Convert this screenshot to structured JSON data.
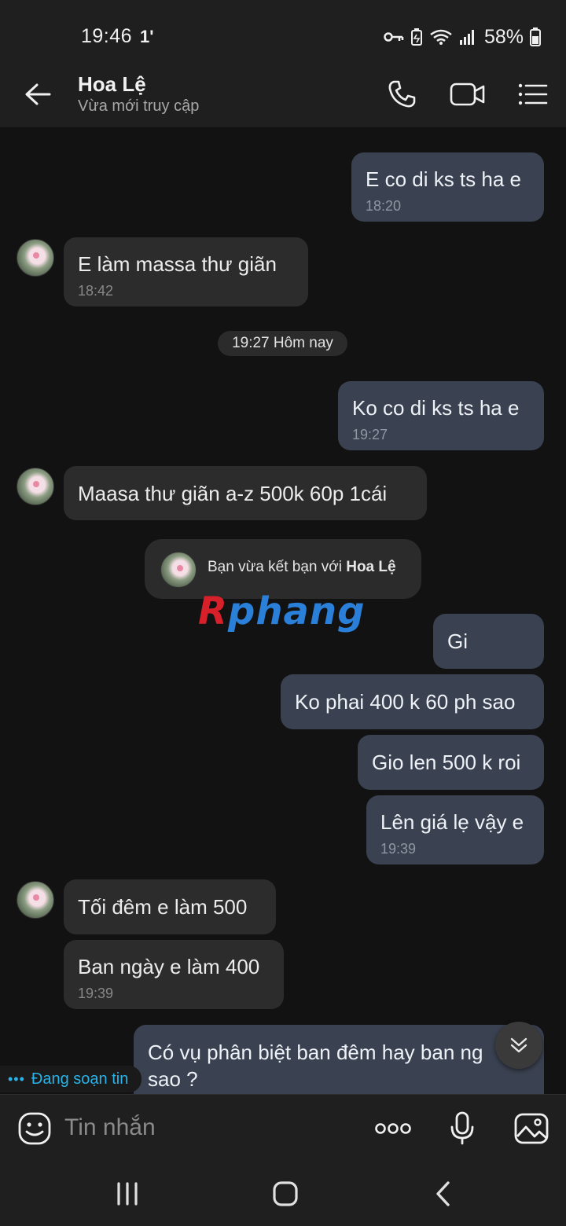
{
  "status_bar": {
    "time": "19:46",
    "time_indicator": "1'",
    "battery": "58%"
  },
  "header": {
    "contact_name": "Hoa Lệ",
    "contact_status": "Vừa mới truy cập"
  },
  "messages": [
    {
      "side": "out",
      "text": "E co di ks ts ha e",
      "time": "18:20"
    },
    {
      "side": "in",
      "text": "E làm massa thư giãn",
      "time": "18:42"
    },
    {
      "side": "out",
      "text": "Ko co di ks ts ha e",
      "time": "19:27"
    },
    {
      "side": "in",
      "text": "Maasa thư giãn a-z 500k 60p 1cái",
      "time": ""
    },
    {
      "side": "out",
      "text": "Gi",
      "time": ""
    },
    {
      "side": "out",
      "text": "Ko phai 400 k 60 ph sao",
      "time": ""
    },
    {
      "side": "out",
      "text": "Gio len 500 k roi",
      "time": ""
    },
    {
      "side": "out",
      "text": "Lên giá lẹ vậy e",
      "time": "19:39"
    },
    {
      "side": "in",
      "text": "Tối đêm e làm 500",
      "time": ""
    },
    {
      "side": "in",
      "text": "Ban ngày e làm 400",
      "time": "19:39"
    },
    {
      "side": "out",
      "text": "Có vụ phân biệt ban đêm hay ban ng\nsao ?",
      "time": ""
    }
  ],
  "date_separator": "19:27 Hôm nay",
  "friend_notice": {
    "prefix": "Bạn vừa kết bạn với ",
    "name": "Hoa Lệ"
  },
  "watermark": {
    "first_letter": "R",
    "rest": "phang"
  },
  "typing_indicator": {
    "dots": "•••",
    "text": "Đang soạn tin"
  },
  "composer": {
    "placeholder": "Tin nhắn"
  },
  "icons": {
    "back": "arrow-left-icon",
    "call": "phone-icon",
    "video": "video-camera-icon",
    "menu": "list-menu-icon",
    "emoji": "emoji-icon",
    "more": "more-dots-icon",
    "mic": "microphone-icon",
    "image": "image-icon",
    "scroll_down": "chevron-double-down-icon"
  },
  "colors": {
    "outgoing_bubble": "#3a4150",
    "incoming_bubble": "#2c2c2c",
    "background": "#121212",
    "bar": "#1f1f1f",
    "typing_accent": "#29b3e8"
  }
}
